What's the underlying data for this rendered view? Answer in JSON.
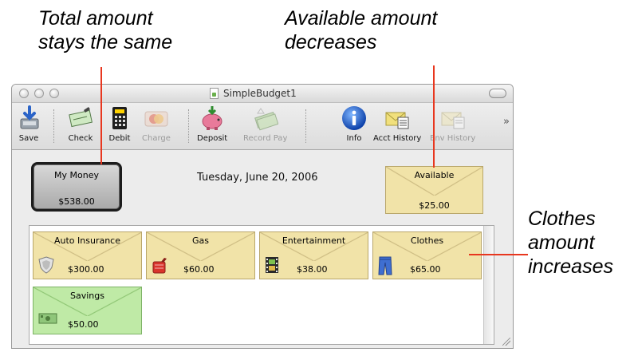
{
  "annotations": {
    "total": [
      "Total amount",
      "stays the same"
    ],
    "available": [
      "Available amount",
      "decreases"
    ],
    "clothes": [
      "Clothes",
      "amount",
      "increases"
    ]
  },
  "window": {
    "title": "SimpleBudget1"
  },
  "toolbar": {
    "save": "Save",
    "check": "Check",
    "debit": "Debit",
    "charge": "Charge",
    "deposit": "Deposit",
    "record_pay": "Record Pay",
    "info": "Info",
    "acct_history": "Acct History",
    "env_history": "Env History",
    "overflow": "»"
  },
  "summary": {
    "my_money_label": "My Money",
    "my_money_value": "$538.00",
    "date": "Tuesday, June 20, 2006",
    "available_label": "Available",
    "available_value": "$25.00"
  },
  "envelopes": [
    {
      "name": "Auto Insurance",
      "amount": "$300.00",
      "icon": "shield-icon",
      "color": "#f1e3a8"
    },
    {
      "name": "Gas",
      "amount": "$60.00",
      "icon": "gas-can-icon",
      "color": "#f1e3a8"
    },
    {
      "name": "Entertainment",
      "amount": "$38.00",
      "icon": "film-icon",
      "color": "#f1e3a8"
    },
    {
      "name": "Clothes",
      "amount": "$65.00",
      "icon": "jeans-icon",
      "color": "#f1e3a8"
    },
    {
      "name": "Savings",
      "amount": "$50.00",
      "icon": "cash-icon",
      "color": "#bfeaa6"
    }
  ],
  "colors": {
    "annotation_line": "#e8371f",
    "envelope": "#f1e3a8",
    "savings_envelope": "#bfeaa6"
  }
}
